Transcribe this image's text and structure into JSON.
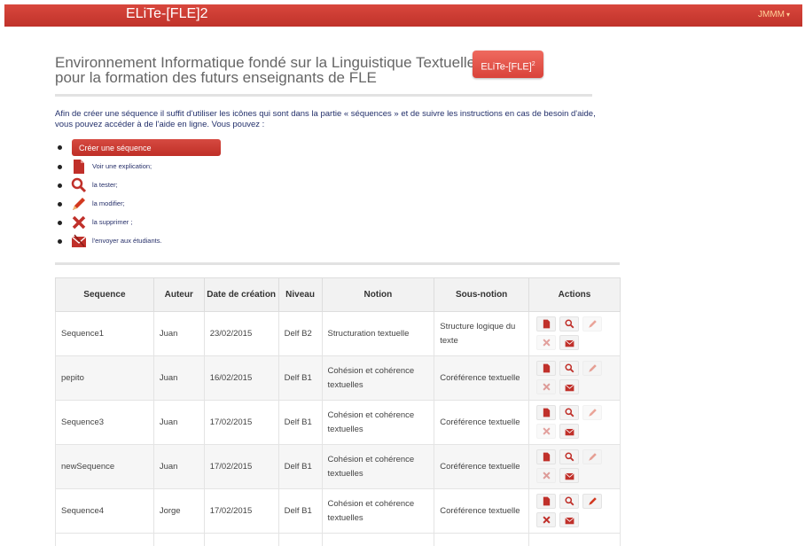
{
  "navbar": {
    "brand": "ELiTe-[FLE]2",
    "user": "JMMM",
    "user_caret": "▾"
  },
  "hero": {
    "title": "Environnement Informatique fondé sur la Linguistique Textuelle",
    "subtitle": "pour la formation des futurs enseignants de FLE",
    "badge": "ELiTe-[FLE]",
    "badge_sup": "2"
  },
  "intro": "Afin de créer une séquence il suffit d'utiliser les icônes qui sont dans la partie « séquences » et de suivre les instructions en cas de besoin d'aide, vous pouvez accéder à de l'aide en ligne. Vous pouvez :",
  "howto": {
    "create_button": "Créer une séquence",
    "items": [
      {
        "icon": "document-icon",
        "label": "Voir une explication;"
      },
      {
        "icon": "magnifier-icon",
        "label": "la tester;"
      },
      {
        "icon": "pencil-icon",
        "label": "la modifier;"
      },
      {
        "icon": "delete-icon",
        "label": "la supprimer ;"
      },
      {
        "icon": "mail-icon",
        "label": "l'envoyer aux étudiants."
      }
    ]
  },
  "table": {
    "headers": {
      "sequence": "Sequence",
      "auteur": "Auteur",
      "date": "Date de création",
      "niveau": "Niveau",
      "notion": "Notion",
      "sous_notion": "Sous-notion",
      "actions": "Actions"
    },
    "rows": [
      {
        "sequence": "Sequence1",
        "auteur": "Juan",
        "date": "23/02/2015",
        "niveau": "Delf B2",
        "notion": "Structuration textuelle",
        "sous_notion": "Structure logique du texte",
        "editable": false
      },
      {
        "sequence": "pepito",
        "auteur": "Juan",
        "date": "16/02/2015",
        "niveau": "Delf B1",
        "notion": "Cohésion et cohérence textuelles",
        "sous_notion": "Coréférence textuelle",
        "editable": false
      },
      {
        "sequence": "Sequence3",
        "auteur": "Juan",
        "date": "17/02/2015",
        "niveau": "Delf B1",
        "notion": "Cohésion et cohérence textuelles",
        "sous_notion": "Coréférence textuelle",
        "editable": false
      },
      {
        "sequence": "newSequence",
        "auteur": "Juan",
        "date": "17/02/2015",
        "niveau": "Delf B1",
        "notion": "Cohésion et cohérence textuelles",
        "sous_notion": "Coréférence textuelle",
        "editable": false
      },
      {
        "sequence": "Sequence4",
        "auteur": "Jorge",
        "date": "17/02/2015",
        "niveau": "Delf B1",
        "notion": "Cohésion et cohérence textuelles",
        "sous_notion": "Coréférence textuelle",
        "editable": true
      }
    ]
  },
  "colors": {
    "brand_red": "#c93a31",
    "link_blue": "#23306b"
  }
}
